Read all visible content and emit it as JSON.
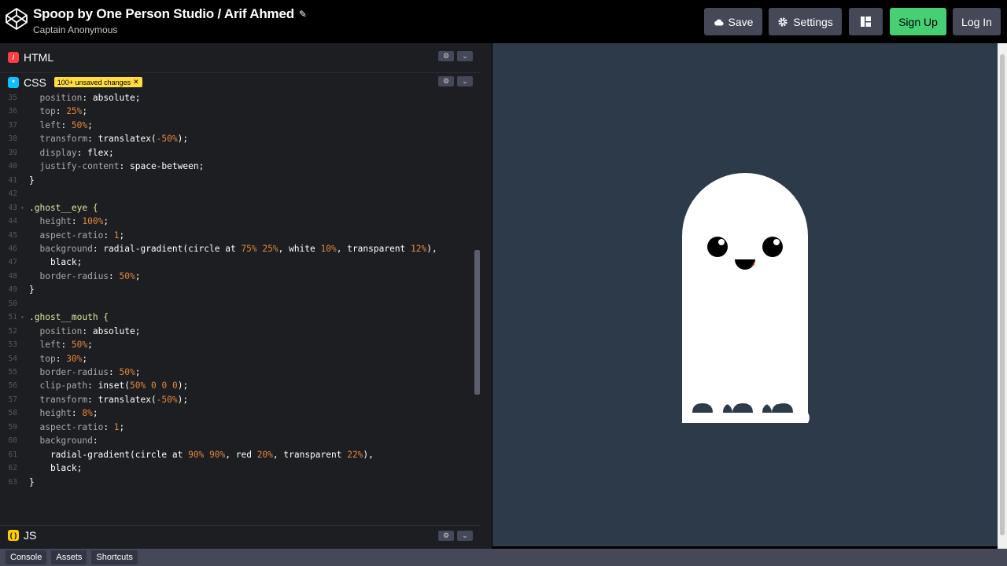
{
  "header": {
    "title": "Spoop by One Person Studio / Arif Ahmed",
    "edit_icon": "pencil-icon",
    "author": "Captain Anonymous",
    "buttons": {
      "save": "Save",
      "settings": "Settings",
      "sign_up": "Sign Up",
      "log_in": "Log In"
    }
  },
  "panes": {
    "html": {
      "label": "HTML"
    },
    "css": {
      "label": "CSS",
      "badge": "100+ unsaved changes"
    },
    "js": {
      "label": "JS"
    }
  },
  "code_lines": [
    {
      "n": "35",
      "t": "  position: absolute;"
    },
    {
      "n": "36",
      "t": "  top: 25%;"
    },
    {
      "n": "37",
      "t": "  left: 50%;"
    },
    {
      "n": "38",
      "t": "  transform: translatex(-50%);"
    },
    {
      "n": "39",
      "t": "  display: flex;"
    },
    {
      "n": "40",
      "t": "  justify-content: space-between;"
    },
    {
      "n": "41",
      "t": "}"
    },
    {
      "n": "42",
      "t": ""
    },
    {
      "n": "43",
      "t": ".ghost__eye {"
    },
    {
      "n": "44",
      "t": "  height: 100%;"
    },
    {
      "n": "45",
      "t": "  aspect-ratio: 1;"
    },
    {
      "n": "46",
      "t": "  background: radial-gradient(circle at 75% 25%, white 10%, transparent 12%),"
    },
    {
      "n": "47",
      "t": "    black;"
    },
    {
      "n": "48",
      "t": "  border-radius: 50%;"
    },
    {
      "n": "49",
      "t": "}"
    },
    {
      "n": "50",
      "t": ""
    },
    {
      "n": "51",
      "t": ".ghost__mouth {"
    },
    {
      "n": "52",
      "t": "  position: absolute;"
    },
    {
      "n": "53",
      "t": "  left: 50%;"
    },
    {
      "n": "54",
      "t": "  top: 30%;"
    },
    {
      "n": "55",
      "t": "  border-radius: 50%;"
    },
    {
      "n": "56",
      "t": "  clip-path: inset(50% 0 0 0);"
    },
    {
      "n": "57",
      "t": "  transform: translatex(-50%);"
    },
    {
      "n": "58",
      "t": "  height: 8%;"
    },
    {
      "n": "59",
      "t": "  aspect-ratio: 1;"
    },
    {
      "n": "60",
      "t": "  background:"
    },
    {
      "n": "61",
      "t": "    radial-gradient(circle at 90% 90%, red 20%, transparent 22%),"
    },
    {
      "n": "62",
      "t": "    black;"
    },
    {
      "n": "63",
      "t": "}"
    }
  ],
  "bottom_bar": {
    "console": "Console",
    "assets": "Assets",
    "shortcuts": "Shortcuts"
  },
  "colors": {
    "accent_green": "#47cf73",
    "preview_bg": "#2c3a4a",
    "badge_yellow": "#ffdd40"
  }
}
